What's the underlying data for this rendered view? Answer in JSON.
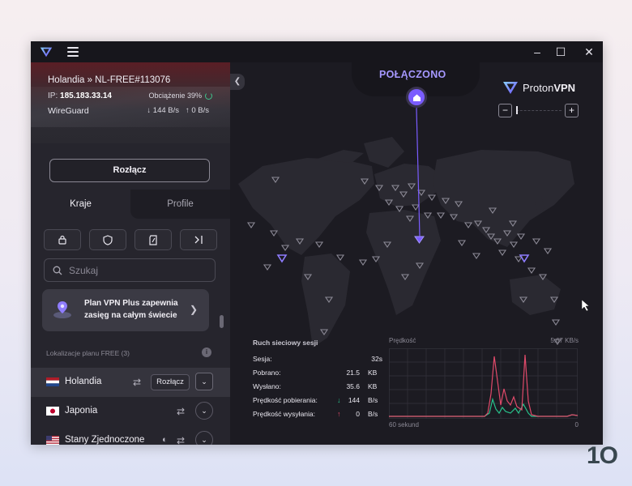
{
  "titlebar": {
    "minimize_glyph": "–",
    "maximize_glyph": "☐",
    "close_glyph": "✕"
  },
  "connection": {
    "server": "Holandia » NL-FREE#113076",
    "ip_label": "IP:",
    "ip": "185.183.33.14",
    "load": "Obciążenie 39%",
    "protocol": "WireGuard",
    "download_speed": "↓ 144 B/s",
    "upload_speed": "↑ 0 B/s",
    "disconnect_label": "Rozłącz"
  },
  "tabs": {
    "countries": "Kraje",
    "profiles": "Profile"
  },
  "filters": [
    "lock-icon",
    "shield-icon",
    "p2p-icon",
    "tor-icon"
  ],
  "search": {
    "placeholder": "Szukaj"
  },
  "promo": {
    "text": "Plan VPN Plus zapewnia zasięg na całym świecie"
  },
  "free_section": {
    "label": "Lokalizacje planu FREE (3)"
  },
  "countries": [
    {
      "name": "Holandia",
      "action": "Rozłącz",
      "selected": true
    },
    {
      "name": "Japonia"
    },
    {
      "name": "Stany Zjednoczone"
    }
  ],
  "map": {
    "status": "POŁĄCZONO",
    "brand_a": "Proton",
    "brand_b": "VPN",
    "zoom_in": "+",
    "zoom_out": "−"
  },
  "session": {
    "title": "Ruch sieciowy sesji",
    "rows": [
      {
        "label": "Sesja:",
        "value": "32s",
        "unit": ""
      },
      {
        "label": "Pobrano:",
        "value": "21.5",
        "unit": "KB"
      },
      {
        "label": "Wysłano:",
        "value": "35.6",
        "unit": "KB"
      },
      {
        "label": "Prędkość pobierania:",
        "value": "144",
        "unit": "B/s",
        "arrow": "↓"
      },
      {
        "label": "Prędkość wysyłania:",
        "value": "0",
        "unit": "B/s",
        "arrow": "↑"
      }
    ]
  },
  "speed_chart": {
    "title": "Prędkość",
    "max_label": "5.67  KB/s",
    "x_start": "60 sekund",
    "x_end": "0",
    "colors": {
      "download": "#e04a6a",
      "upload": "#28c08a"
    }
  },
  "colors": {
    "accent": "#7a5cff",
    "status": "#a698ff"
  }
}
